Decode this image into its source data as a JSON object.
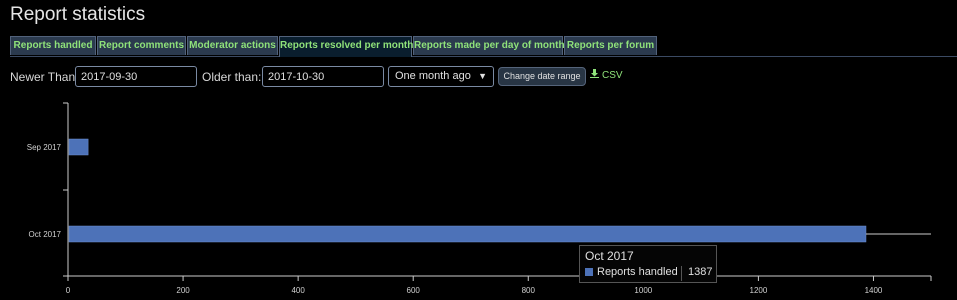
{
  "page": {
    "title": "Report statistics"
  },
  "tabs": [
    {
      "label": "Reports handled",
      "active": false
    },
    {
      "label": "Report comments",
      "active": false
    },
    {
      "label": "Moderator actions",
      "active": false
    },
    {
      "label": "Reports resolved per month",
      "active": true
    },
    {
      "label": "Reports made per day of month",
      "active": false
    },
    {
      "label": "Reports per forum",
      "active": false
    }
  ],
  "filters": {
    "newer_label": "Newer Than:",
    "newer_value": "2017-09-30",
    "older_label": "Older than:",
    "older_value": "2017-10-30",
    "range_select": "One month ago",
    "button_label": "Change date range",
    "csv_label": "CSV"
  },
  "colors": {
    "bar": "#4d72b8",
    "tab_text": "#8fe27a",
    "background": "#000000"
  },
  "icons": {
    "select_arrow": "dropdown-arrow-icon",
    "csv": "download-icon"
  },
  "chart_data": {
    "type": "bar",
    "orientation": "horizontal",
    "categories": [
      "Sep 2017",
      "Oct 2017"
    ],
    "series": [
      {
        "name": "Reports handled",
        "values": [
          35,
          1387
        ]
      }
    ],
    "xlim": [
      0,
      1500
    ],
    "xticks": [
      0,
      200,
      400,
      600,
      800,
      1000,
      1200,
      1400
    ],
    "grid": false,
    "tooltip": {
      "title": "Oct 2017",
      "series": "Reports handled",
      "value": "1387"
    }
  }
}
